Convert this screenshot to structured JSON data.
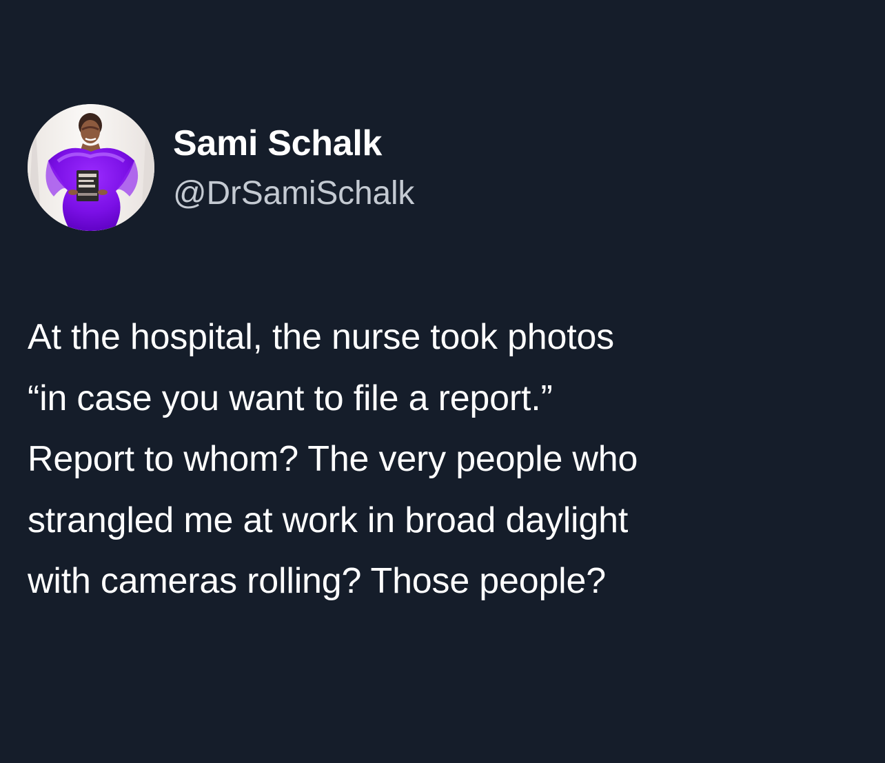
{
  "tweet": {
    "author": {
      "display_name": "Sami Schalk",
      "handle": "@DrSamiSchalk",
      "avatar_icon": "profile-photo-avatar"
    },
    "text_lines": [
      "At the hospital, the nurse took photos",
      "“in case you want to file a report.”",
      "Report to whom? The very people who",
      "strangled me at work in broad daylight",
      "with cameras rolling? Those people?"
    ],
    "colors": {
      "background": "#151d2a",
      "name_text": "#ffffff",
      "handle_text": "#c4cad2",
      "body_text": "#ffffff"
    }
  }
}
